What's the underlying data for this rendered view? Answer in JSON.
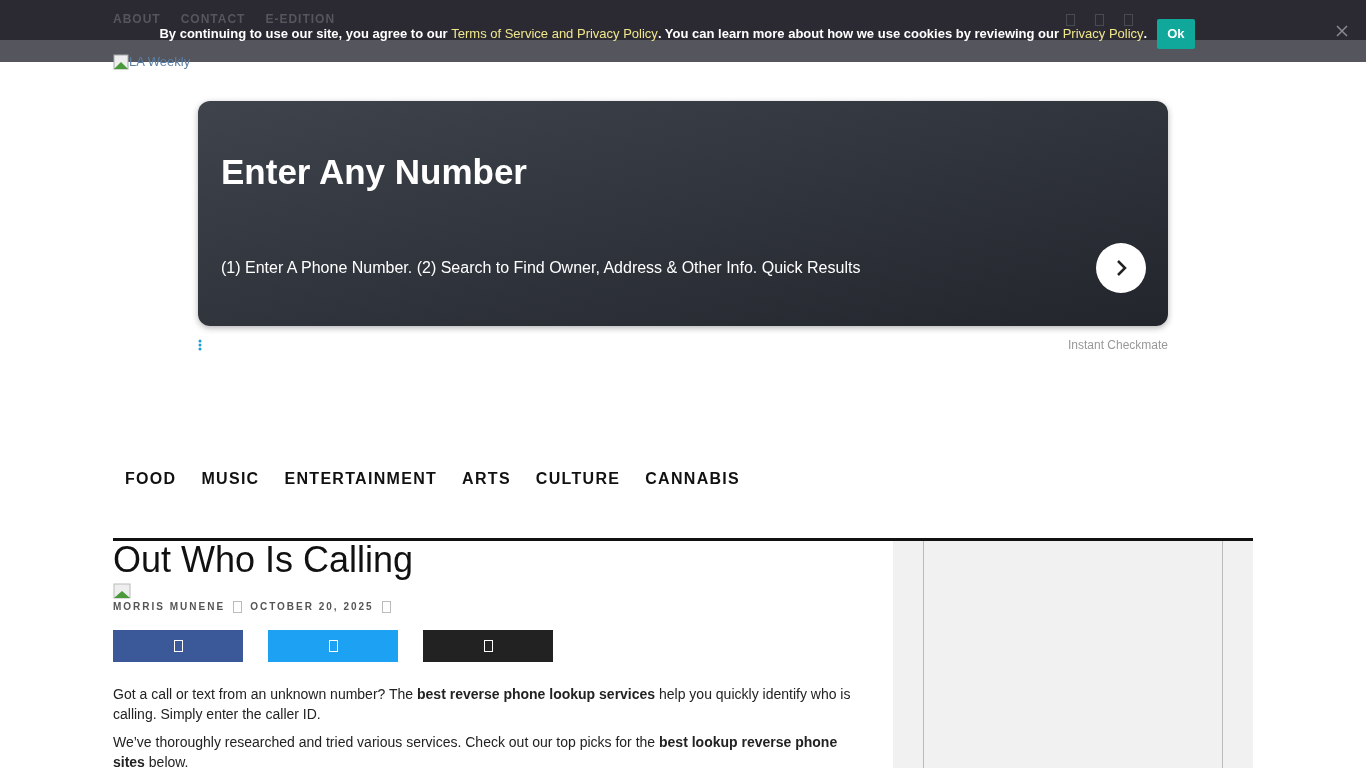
{
  "top_nav": {
    "links": [
      "ABOUT",
      "CONTACT",
      "E-EDITION"
    ]
  },
  "cookie_banner": {
    "text_before": "By continuing to use our site, you agree to our ",
    "link_1": "Terms of Service and Privacy Policy",
    "text_middle": ". You can learn more about how we use cookies by reviewing our ",
    "link_2": "Privacy Policy",
    "text_after": ".",
    "button": "Ok"
  },
  "logo": {
    "alt": "LA Weekly"
  },
  "ad": {
    "title": "Enter Any Number",
    "description": "(1) Enter A Phone Number. (2) Search to Find Owner, Address & Other Info. Quick Results",
    "sponsor": "Instant Checkmate"
  },
  "main_nav": [
    "FOOD",
    "MUSIC",
    "ENTERTAINMENT",
    "ARTS",
    "CULTURE",
    "CANNABIS"
  ],
  "article": {
    "title": "Out Who Is Calling",
    "author": "MORRIS MUNENE",
    "date": "OCTOBER 20, 2025",
    "share_buttons": [
      {
        "color": "#3b5998"
      },
      {
        "color": "#1da1f2"
      },
      {
        "color": "#222222"
      }
    ],
    "paragraphs": [
      "Got a call or text from an unknown number? The **best reverse phone lookup services** help you quickly identify who is calling. Simply enter the caller ID.",
      "We’ve thoroughly researched and tried various services. Check out our top picks for the **best lookup reverse phone sites** below."
    ]
  }
}
